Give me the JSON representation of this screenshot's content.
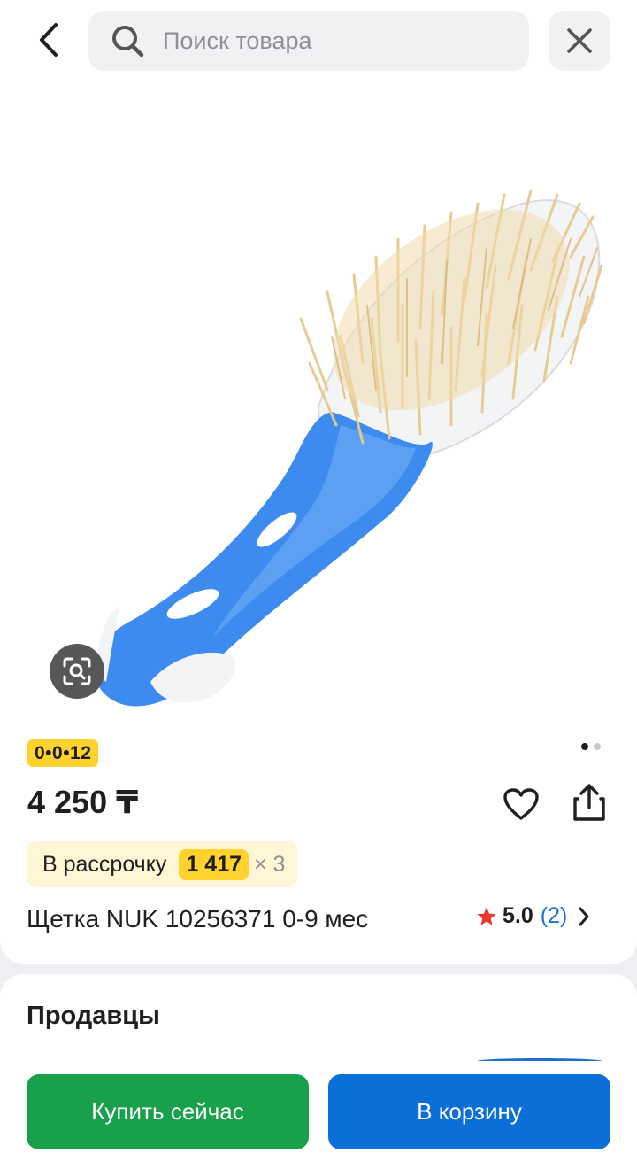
{
  "header": {
    "back_icon": "chevron-left-icon",
    "search_icon": "search-icon",
    "search_placeholder": "Поиск товара",
    "search_value": "",
    "close_icon": "close-icon"
  },
  "product": {
    "image_alt": "Щетка NUK",
    "lens_icon": "visual-search-icon",
    "gallery_total": 2,
    "gallery_active": 1,
    "promo_badge": "0•0•12",
    "price": "4 250 ₸",
    "favorite_icon": "heart-icon",
    "share_icon": "share-icon",
    "installment": {
      "label": "В рассрочку",
      "amount": "1 417",
      "multiplier": "× 3"
    },
    "title": "Щетка NUK 10256371 0-9 мес",
    "rating": {
      "star_icon": "star-icon",
      "value": "5.0",
      "count": "(2)",
      "chevron_icon": "chevron-right-icon"
    }
  },
  "sellers": {
    "title": "Продавцы"
  },
  "actions": {
    "buy_now": "Купить сейчас",
    "add_to_cart": "В корзину"
  },
  "colors": {
    "buy_green": "#19a04b",
    "cart_blue": "#0a6fd6",
    "promo_yellow": "#ffd22e",
    "installment_bg": "#fff6d6",
    "rating_star": "#e8382f",
    "link_blue": "#1d6fc7"
  }
}
